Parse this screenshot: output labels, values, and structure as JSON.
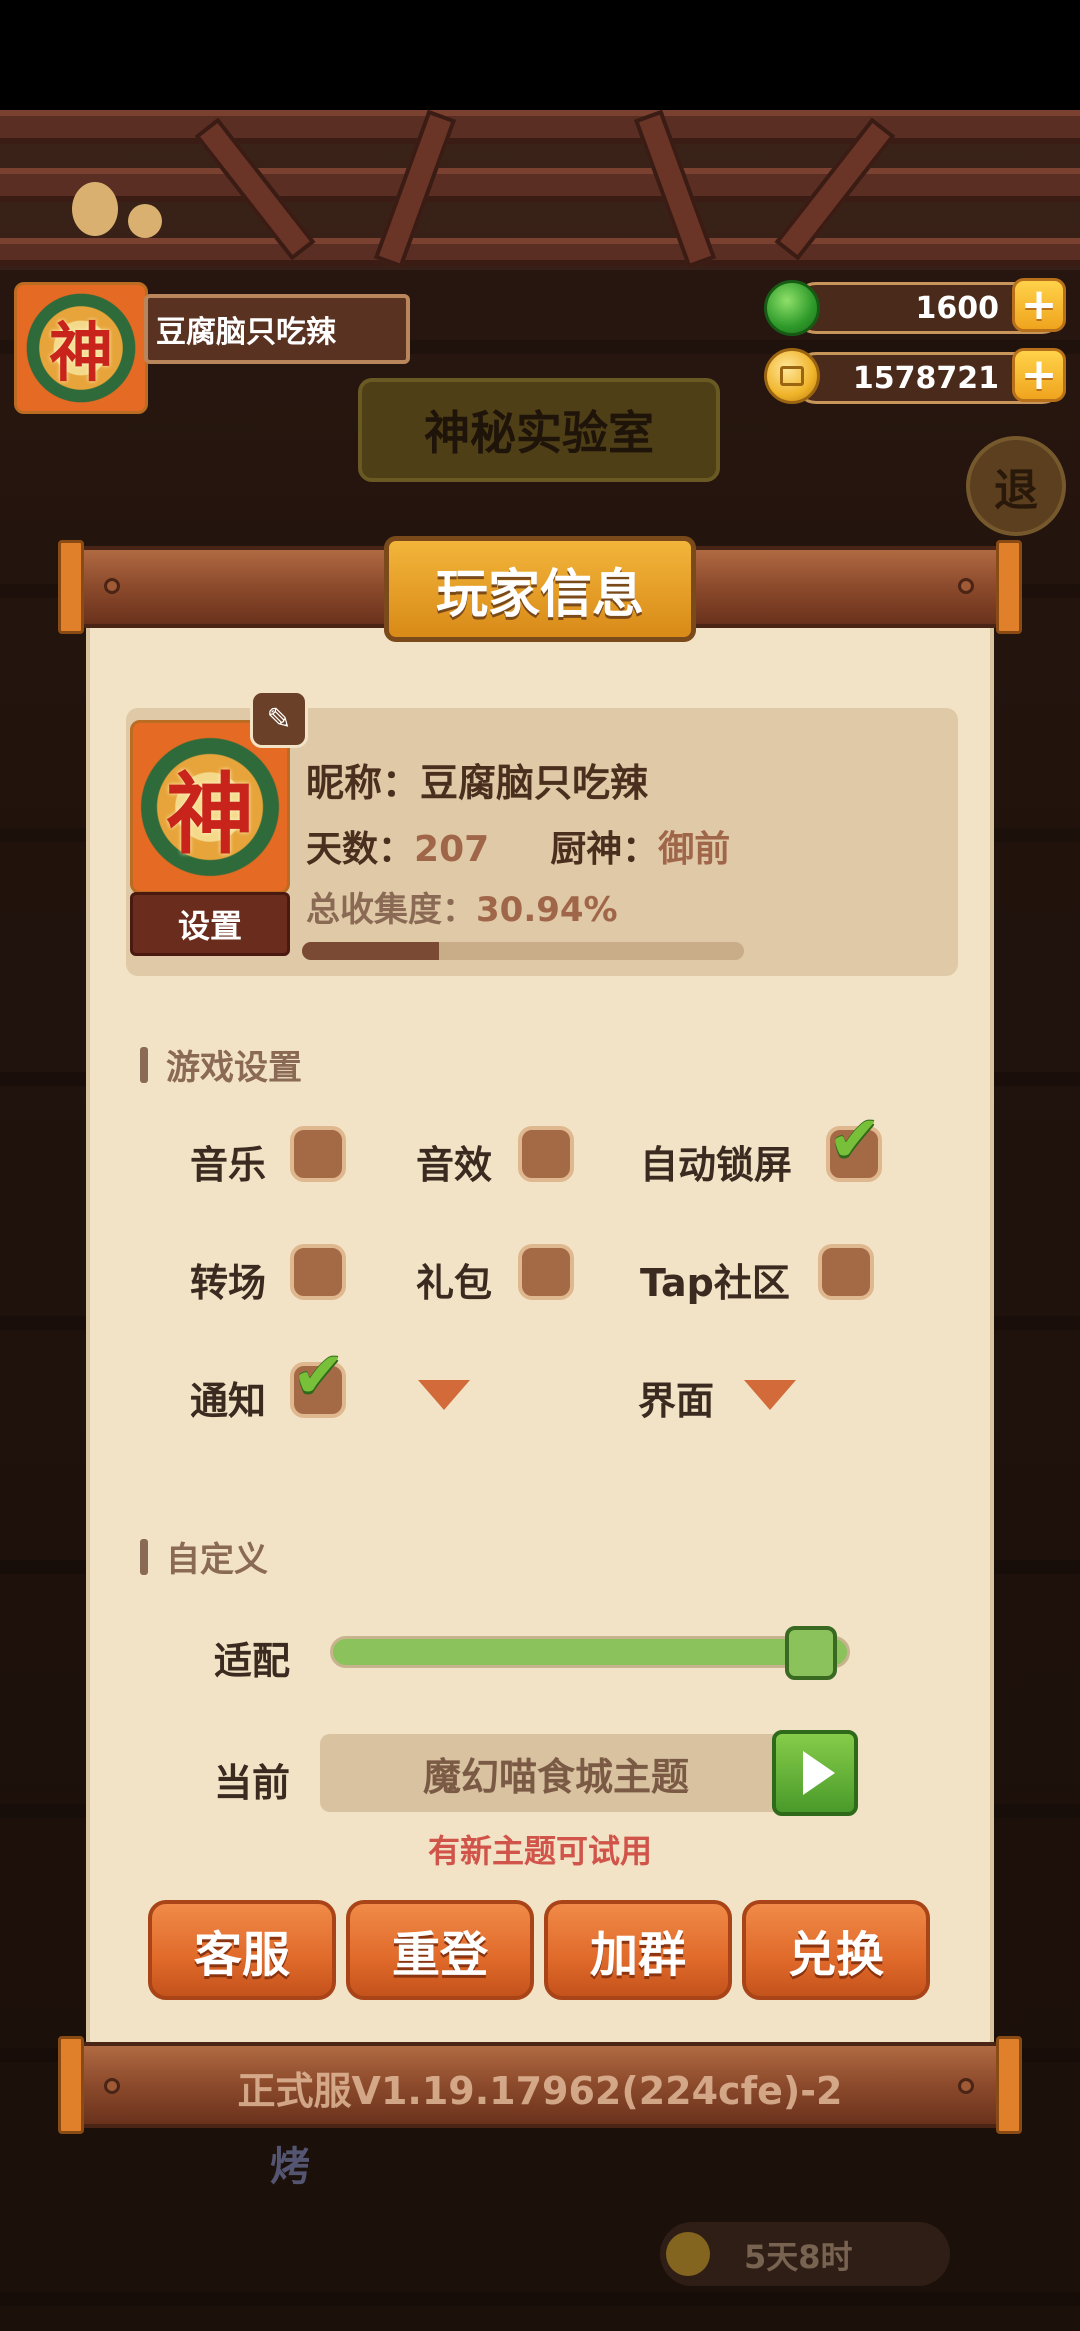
{
  "hud": {
    "player_name": "豆腐脑只吃辣",
    "avatar_glyph": "神",
    "jade": "1600",
    "coins": "1578721",
    "lab_title": "神秘实验室",
    "exit_glyph": "退"
  },
  "dialog": {
    "title": "玩家信息",
    "profile": {
      "avatar_glyph": "神",
      "settings_label": "设置",
      "nickname_label": "昵称：",
      "nickname": "豆腐脑只吃辣",
      "days_label": "天数：",
      "days": "207",
      "chef_label": "厨神：",
      "chef": "御前",
      "collection_label": "总收集度：",
      "collection": "30.94%",
      "collection_fraction": 0.3094
    },
    "game_settings": {
      "header": "游戏设置",
      "options": [
        {
          "label": "音乐",
          "checked": false
        },
        {
          "label": "音效",
          "checked": false
        },
        {
          "label": "自动锁屏",
          "checked": true
        },
        {
          "label": "转场",
          "checked": false
        },
        {
          "label": "礼包",
          "checked": false
        },
        {
          "label": "Tap社区",
          "checked": false
        },
        {
          "label": "通知",
          "checked": true
        },
        {
          "label": "",
          "type": "dropdown"
        },
        {
          "label": "界面",
          "type": "dropdown"
        }
      ]
    },
    "custom": {
      "header": "自定义",
      "fit_label": "适配",
      "fit_fraction": 0.95,
      "current_label": "当前",
      "theme": "魔幻喵食城主题",
      "hint": "有新主题可试用"
    },
    "buttons": {
      "support": "客服",
      "relogin": "重登",
      "join_group": "加群",
      "redeem": "兑换"
    },
    "version": "正式服V1.19.17962(224cfe)-2"
  },
  "bottom": {
    "grill_glyph": "烤",
    "timer": "5天8时"
  }
}
